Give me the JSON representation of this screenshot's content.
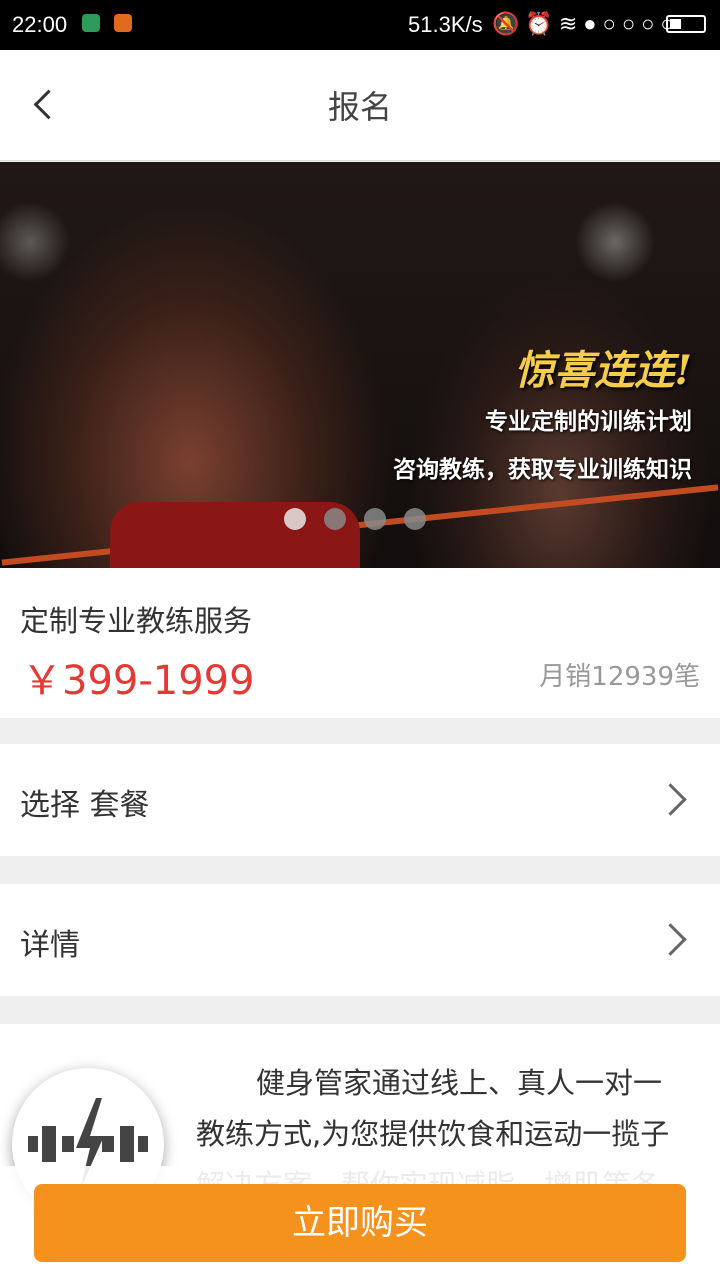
{
  "status_bar": {
    "time": "22:00",
    "network_speed": "51.3K/s",
    "icons": [
      "mute-bell-icon",
      "alarm-icon",
      "wifi-icon",
      "signal-dots-icon",
      "battery-icon"
    ],
    "signal_dots": "●○○○○",
    "battery_level": 0.35
  },
  "nav": {
    "title": "报名",
    "back_icon": "chevron-left-icon"
  },
  "banner": {
    "headline": "惊喜连连!",
    "line1": "专业定制的训练计划",
    "line2": "咨询教练，获取专业训练知识",
    "page_count": 4,
    "active_page": 1
  },
  "product": {
    "name": "定制专业教练服务",
    "price": "￥399-1999",
    "monthly_sales": "月销12939笔"
  },
  "rows": {
    "package_label": "选择 套餐",
    "detail_label": "详情"
  },
  "detail": {
    "description": "健身管家通过线上、真人一对一教练方式,为您提供饮食和运动一揽子解决方案，帮你实现减脂、增肌等各种健身目标！"
  },
  "buy_button": {
    "label": "立即购买",
    "color": "#f5921d"
  },
  "colors": {
    "price": "#e53935",
    "banner_headline": "#f6cd4a"
  }
}
